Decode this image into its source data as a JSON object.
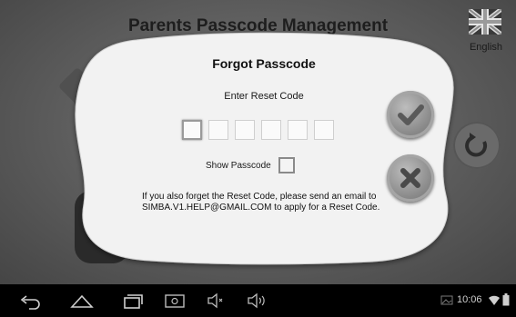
{
  "background": {
    "title": "Parents Passcode Management",
    "language_label": "English",
    "flag_icon": "uk-flag-icon"
  },
  "dialog": {
    "title": "Forgot Passcode",
    "enter_label": "Enter Reset Code",
    "code_digits": [
      "",
      "",
      "",
      "",
      "",
      ""
    ],
    "show_passcode_label": "Show Passcode",
    "show_passcode_checked": false,
    "help_text": "If you also forget the Reset Code, please send an email to SIMBA.V1.HELP@GMAIL.COM to apply for a Reset Code.",
    "confirm_icon": "checkmark-icon",
    "cancel_icon": "close-icon"
  },
  "system_bar": {
    "time": "10:06",
    "icons": [
      "back-icon",
      "home-icon",
      "recent-apps-icon",
      "screenshot-icon",
      "volume-down-icon",
      "volume-up-icon",
      "image-notification-icon",
      "wifi-icon",
      "battery-icon"
    ]
  },
  "colors": {
    "dialog_bg": "#f2f2f2",
    "app_bg": "#6a6a6a",
    "button_gray": "#8c8c8c"
  }
}
